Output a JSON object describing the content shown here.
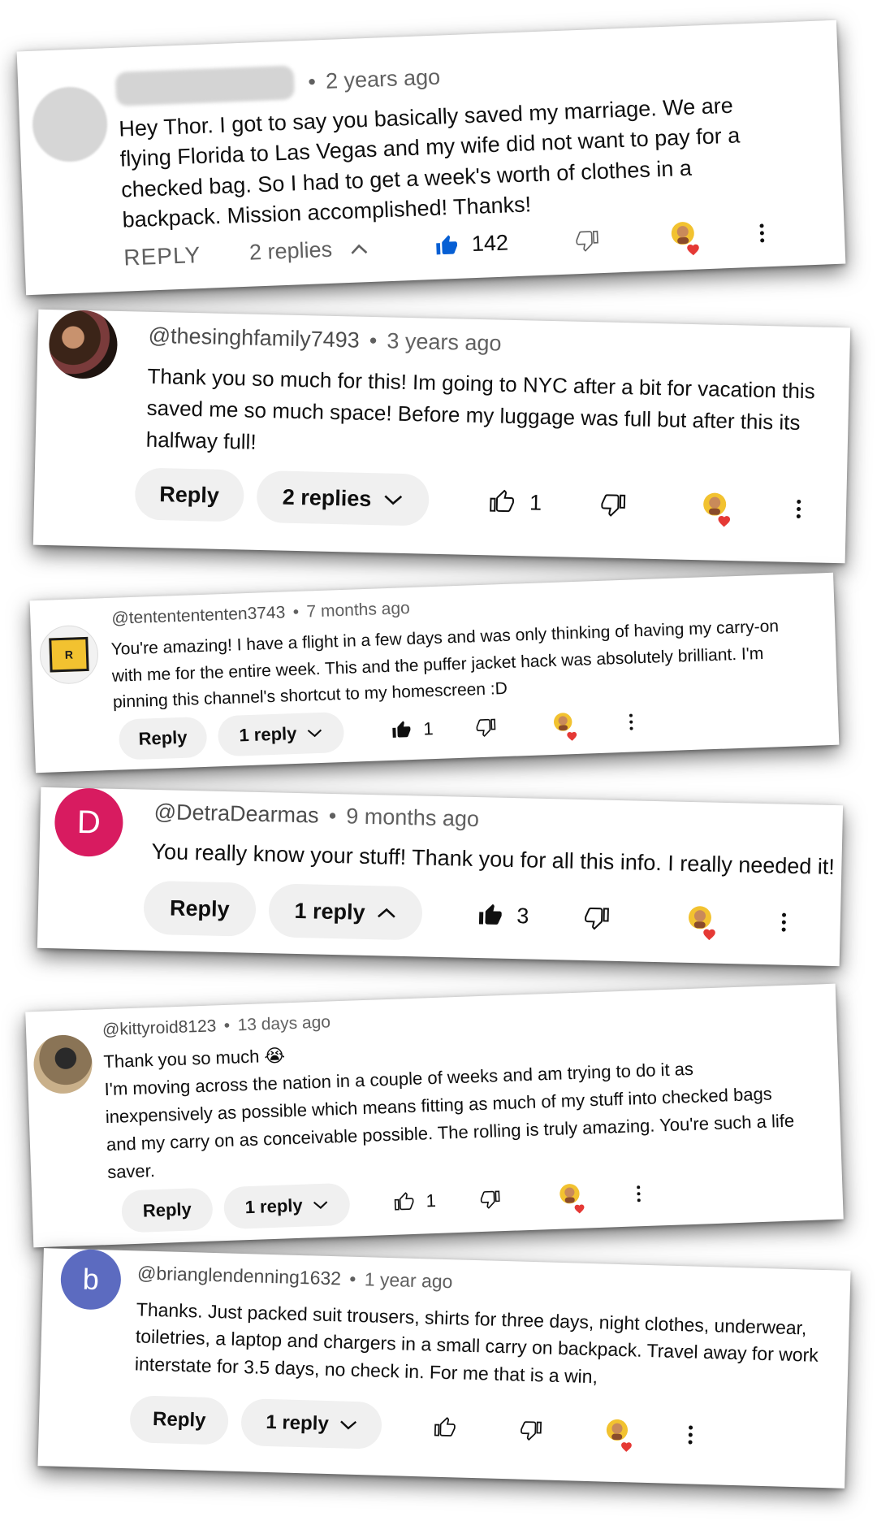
{
  "comments": [
    {
      "handle": "",
      "time": "2 years ago",
      "lines": [
        "Hey Thor. I got to say you basically saved my marriage. We are",
        "flying Florida to Las Vegas and my wife did not want to pay for a",
        "checked bag. So I had to get a week's worth of clothes in a",
        "backpack. Mission accomplished! Thanks!"
      ],
      "reply_label": "REPLY",
      "replies_label": "2 replies",
      "likes": "142",
      "avatar_letter": "",
      "avatar_color": "#d6d6d6"
    },
    {
      "handle": "@thesinghfamily7493",
      "time": "3 years ago",
      "lines": [
        "Thank you so much for this! Im going to NYC after a bit for vacation this",
        "saved me so much space! Before my luggage was full but after this its",
        "halfway full!"
      ],
      "reply_label": "Reply",
      "replies_label": "2 replies",
      "likes": "1",
      "avatar_letter": "",
      "avatar_color": "#5a3b2e"
    },
    {
      "handle": "@tententententen3743",
      "time": "7 months ago",
      "lines": [
        "You're amazing! I have a flight in a few days and was only thinking of having my carry-on",
        "with me for the entire week. This and the puffer jacket hack was absolutely brilliant. I'm",
        "pinning this channel's shortcut to my homescreen :D"
      ],
      "reply_label": "Reply",
      "replies_label": "1 reply",
      "likes": "1",
      "avatar_letter": "R",
      "avatar_color": "#f2f2f2"
    },
    {
      "handle": "@DetraDearmas",
      "time": "9 months ago",
      "lines": [
        "You really know your stuff! Thank you for all this info. I really needed it!"
      ],
      "reply_label": "Reply",
      "replies_label": "1 reply",
      "likes": "3",
      "avatar_letter": "D",
      "avatar_color": "#d81b60"
    },
    {
      "handle": "@kittyroid8123",
      "time": "13 days ago",
      "lines": [
        "Thank you so much 😭",
        "I'm moving across the nation in a couple of weeks and am trying to do it as",
        "inexpensively as possible which means fitting as much of my stuff into checked bags",
        "and my carry on as conceivable possible. The rolling is truly amazing. You're such a life",
        "saver."
      ],
      "reply_label": "Reply",
      "replies_label": "1 reply",
      "likes": "1",
      "avatar_letter": "",
      "avatar_color": "#6b5a44"
    },
    {
      "handle": "@brianglendenning1632",
      "time": "1 year ago",
      "lines": [
        "Thanks.  Just packed suit trousers, shirts for three days, night clothes, underwear,",
        "toiletries, a laptop and chargers in a small carry on backpack. Travel away for work",
        "interstate for 3.5 days, no check in. For me that is a win,"
      ],
      "reply_label": "Reply",
      "replies_label": "1 reply",
      "likes": "",
      "avatar_letter": "b",
      "avatar_color": "#5c6bc0"
    }
  ],
  "colors": {
    "like_filled": "#065fd4",
    "heart": "#e53935",
    "pill_bg": "#f0f0f0",
    "meta_text": "#606060"
  },
  "icons": [
    "thumbs-up-icon",
    "thumbs-down-icon",
    "chevron-up-icon",
    "chevron-down-icon",
    "creator-heart-icon",
    "more-vert-icon"
  ]
}
